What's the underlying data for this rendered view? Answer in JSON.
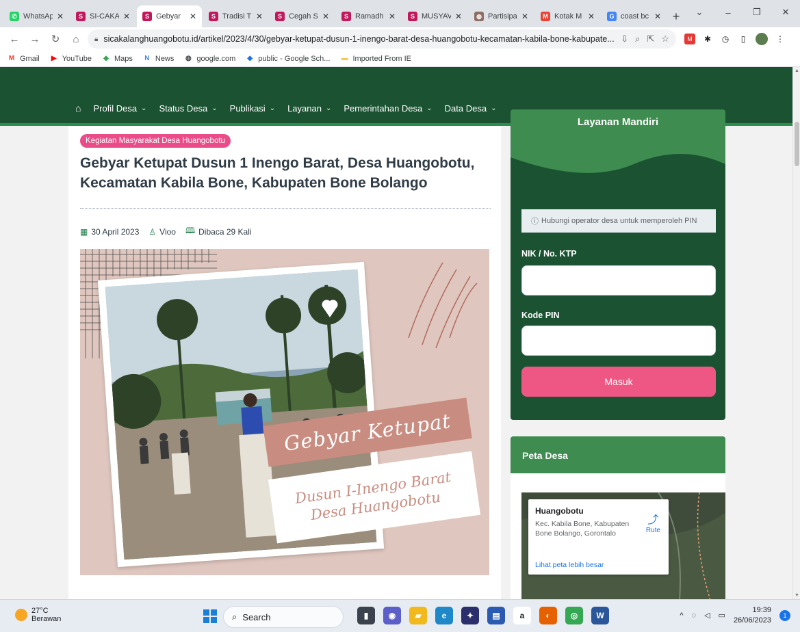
{
  "browser": {
    "tabs": [
      {
        "label": "WhatsAp",
        "icon": "whatsapp-icon",
        "color": "#25d366",
        "glyph": "✆"
      },
      {
        "label": "SI-CAKA",
        "icon": "site-logo-icon",
        "color": "#c2185b",
        "glyph": "S"
      },
      {
        "label": "Gebyar",
        "icon": "site-logo-icon",
        "color": "#c2185b",
        "glyph": "S",
        "active": true
      },
      {
        "label": "Tradisi T",
        "icon": "site-logo-icon",
        "color": "#c2185b",
        "glyph": "S"
      },
      {
        "label": "Cegah S",
        "icon": "site-logo-icon",
        "color": "#c2185b",
        "glyph": "S"
      },
      {
        "label": "Ramadh",
        "icon": "site-logo-icon",
        "color": "#c2185b",
        "glyph": "S"
      },
      {
        "label": "MUSYAV",
        "icon": "site-logo-icon",
        "color": "#c2185b",
        "glyph": "S"
      },
      {
        "label": "Partisipa",
        "icon": "globe-icon",
        "color": "#8d6e63",
        "glyph": "◍"
      },
      {
        "label": "Kotak M",
        "icon": "gmail-icon",
        "color": "#ea4335",
        "glyph": "M"
      },
      {
        "label": "coast bc",
        "icon": "google-icon",
        "color": "#4285f4",
        "glyph": "G"
      }
    ],
    "url": "sicakalanghuangobotu.id/artikel/2023/4/30/gebyar-ketupat-dusun-1-inengo-barat-desa-huangobotu-kecamatan-kabila-bone-kabupate...",
    "bookmarks": [
      {
        "label": "Gmail",
        "icon": "gmail-icon",
        "color": "#ea4335",
        "glyph": "M"
      },
      {
        "label": "YouTube",
        "icon": "youtube-icon",
        "color": "#ff0000",
        "glyph": "▶"
      },
      {
        "label": "Maps",
        "icon": "maps-icon",
        "color": "#34a853",
        "glyph": "◆"
      },
      {
        "label": "News",
        "icon": "news-icon",
        "color": "#4285f4",
        "glyph": "N"
      },
      {
        "label": "google.com",
        "icon": "globe-icon",
        "color": "#3c4043",
        "glyph": "◍"
      },
      {
        "label": "public - Google Sch...",
        "icon": "scholar-icon",
        "color": "#1a73e8",
        "glyph": "◆"
      },
      {
        "label": "Imported From IE",
        "icon": "folder-icon",
        "color": "#f9c74f",
        "glyph": "▬"
      }
    ]
  },
  "site": {
    "menu": [
      "Profil Desa",
      "Status Desa",
      "Publikasi",
      "Layanan",
      "Pemerintahan Desa",
      "Data Desa"
    ],
    "colors": {
      "primary": "#1a5232",
      "accent": "#ea4c89",
      "header_green": "#3e8c4f"
    }
  },
  "article": {
    "category": "Kegiatan Masyarakat Desa Huangobotu",
    "title": "Gebyar Ketupat Dusun 1 Inengo Barat, Desa Huangobotu, Kecamatan Kabila Bone, Kabupaten Bone Bolango",
    "date": "30 April 2023",
    "author": "Vioo",
    "views": "Dibaca 29 Kali",
    "hero_title": "Gebyar Ketupat",
    "hero_sub1": "Dusun I-Inengo Barat",
    "hero_sub2": "Desa Huangobotu"
  },
  "sidebar": {
    "login": {
      "title": "Layanan Mandiri",
      "note": "Hubungi operator desa untuk memperoleh PIN",
      "nik_label": "NIK / No. KTP",
      "pin_label": "Kode PIN",
      "button": "Masuk"
    },
    "map": {
      "title": "Peta Desa",
      "place": "Huangobotu",
      "address": "Kec. Kabila Bone, Kabupaten Bone Bolango, Gorontalo",
      "route": "Rute",
      "bigger_map": "Lihat peta lebih besar"
    }
  },
  "taskbar": {
    "temperature": "27°C",
    "weather": "Berawan",
    "search_placeholder": "Search",
    "time": "19:39",
    "date": "26/06/2023",
    "notifications": "1"
  }
}
